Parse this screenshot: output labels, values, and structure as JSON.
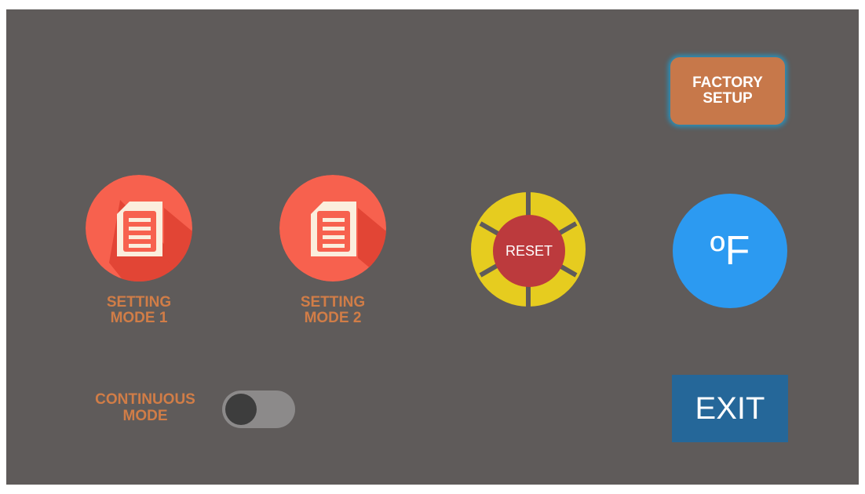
{
  "factory_setup": {
    "line1": "FACTORY",
    "line2": "SETUP"
  },
  "setting_mode_1": {
    "line1": "SETTING",
    "line2": "MODE 1",
    "icon": "document-icon"
  },
  "setting_mode_2": {
    "line1": "SETTING",
    "line2": "MODE 2",
    "icon": "document-icon"
  },
  "reset": {
    "label": "RESET"
  },
  "unit": {
    "label": "ºF"
  },
  "continuous_mode": {
    "line1": "CONTINUOUS",
    "line2": "MODE",
    "enabled": false
  },
  "exit": {
    "label": "EXIT"
  },
  "colors": {
    "background": "#5f5b5a",
    "accent_orange": "#c7784a",
    "label_orange": "#d17d47",
    "mode_red": "#f7614e",
    "reset_yellow": "#e6cc1f",
    "reset_red": "#bc3a3d",
    "unit_blue": "#2c9af1",
    "exit_blue": "#256799"
  }
}
